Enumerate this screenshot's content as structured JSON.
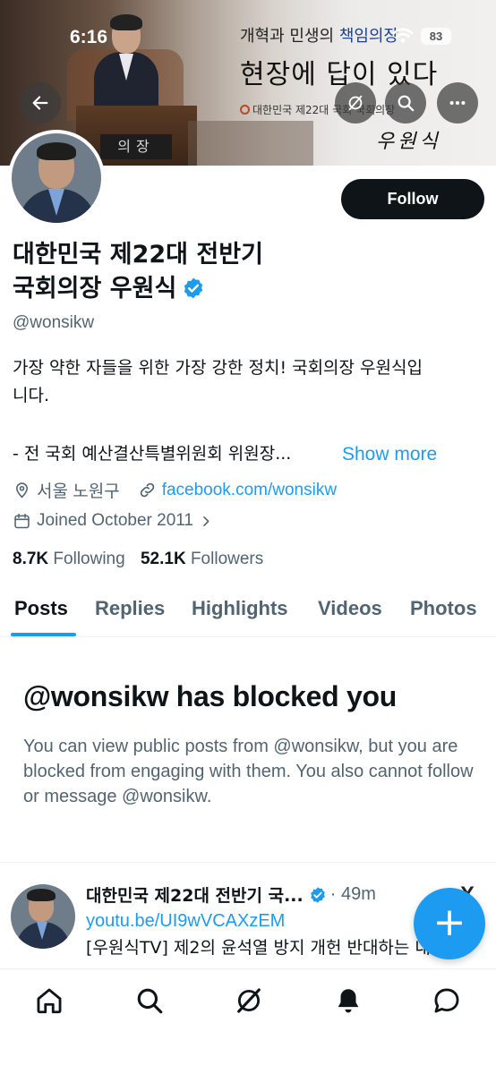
{
  "status_bar": {
    "time": "6:16",
    "battery": "83"
  },
  "banner": {
    "line1_prefix": "개혁과 민생의 ",
    "line1_highlight": "책임의장",
    "line2": "현장에 답이 있다",
    "line3": "대한민국 제22대 국회 국회의장",
    "signature": "우원식",
    "nameplate": "의장"
  },
  "profile": {
    "follow_label": "Follow",
    "name_line1": "대한민국 제22대 전반기",
    "name_line2": "국회의장 우원식",
    "handle": "@wonsikw",
    "bio_line1": "가장 약한 자들을 위한 가장 강한 정치! 국회의장 우원식입",
    "bio_line2": "니다.",
    "bio_line3": "- 전 국회 예산결산특별위원회 위원장...",
    "show_more": "Show more",
    "location": "서울 노원구",
    "website": "facebook.com/wonsikw",
    "joined": "Joined October 2011",
    "following_count": "8.7K",
    "following_label": "Following",
    "followers_count": "52.1K",
    "followers_label": "Followers"
  },
  "tabs": [
    "Posts",
    "Replies",
    "Highlights",
    "Videos",
    "Photos"
  ],
  "blocked": {
    "title": "@wonsikw has blocked you",
    "message": "You can view public posts from @wonsikw, but you are blocked from engaging with them. You also cannot follow or message @wonsikw."
  },
  "post": {
    "author": "대한민국 제22대 전반기 국...",
    "time": "49m",
    "link": "youtu.be/UI9wVCAXzEM",
    "text": "[우원식TV] 제2의 윤석열 방지 개헌 반대하는 내"
  },
  "fab_label": "+",
  "colors": {
    "accent": "#1d9bf0",
    "text": "#0f1419",
    "secondary": "#536471"
  },
  "icons": [
    "back-arrow-icon",
    "grok-icon",
    "search-icon",
    "more-icon",
    "location-icon",
    "link-icon",
    "calendar-icon",
    "chevron-right-icon",
    "verified-badge-icon",
    "home-icon",
    "explore-icon",
    "bell-icon",
    "messages-icon"
  ]
}
